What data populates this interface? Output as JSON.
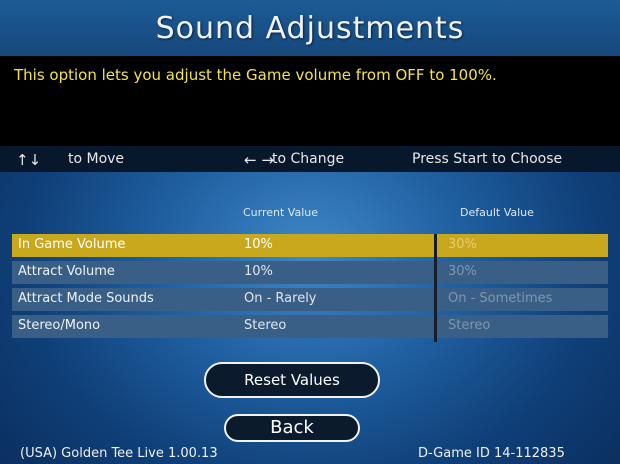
{
  "header": {
    "title": "Sound Adjustments"
  },
  "description": "This option lets you adjust the Game volume from OFF to 100%.",
  "controls": {
    "move_arrows": "↑↓",
    "move_text": "to Move",
    "change_arrows": "← →",
    "change_text": "to Change",
    "start_text": "Press Start to Choose"
  },
  "columns": {
    "current": "Current Value",
    "default": "Default Value"
  },
  "settings": [
    {
      "name": "In Game Volume",
      "current": "10%",
      "default": "30%",
      "selected": true
    },
    {
      "name": "Attract Volume",
      "current": "10%",
      "default": "30%",
      "selected": false
    },
    {
      "name": "Attract Mode Sounds",
      "current": "On - Rarely",
      "default": "On - Sometimes",
      "selected": false
    },
    {
      "name": "Stereo/Mono",
      "current": "Stereo",
      "default": "Stereo",
      "selected": false
    }
  ],
  "buttons": {
    "reset": "Reset Values",
    "back": "Back"
  },
  "footer": {
    "left": "(USA) Golden Tee Live 1.00.13",
    "right": "D-Game ID 14-112835"
  },
  "colors": {
    "highlight": "#c9a81d",
    "description_text": "#f6e24a",
    "row_bg": "#3a5f86"
  }
}
